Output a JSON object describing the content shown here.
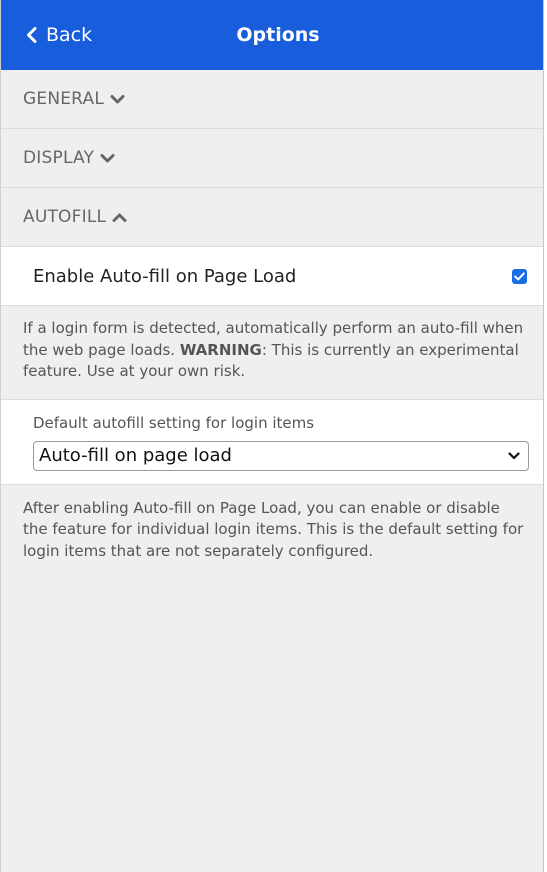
{
  "header": {
    "back_label": "Back",
    "title": "Options"
  },
  "sections": [
    {
      "label": "GENERAL",
      "expanded": false
    },
    {
      "label": "DISPLAY",
      "expanded": false
    },
    {
      "label": "AUTOFILL",
      "expanded": true
    }
  ],
  "autofill": {
    "enable_label": "Enable Auto-fill on Page Load",
    "enable_checked": true,
    "help_prefix": "If a login form is detected, automatically perform an auto-fill when the web page loads. ",
    "help_warning": "WARNING",
    "help_suffix": ": This is currently an experimental feature. Use at your own risk.",
    "default_setting_label": "Default autofill setting for login items",
    "default_setting_value": "Auto-fill on page load",
    "default_help": "After enabling Auto-fill on Page Load, you can enable or disable the feature for individual login items. This is the default setting for login items that are not separately configured."
  },
  "colors": {
    "header_bg": "#175ddc",
    "checkbox": "#1a6ee5",
    "page_bg": "#efefef"
  }
}
